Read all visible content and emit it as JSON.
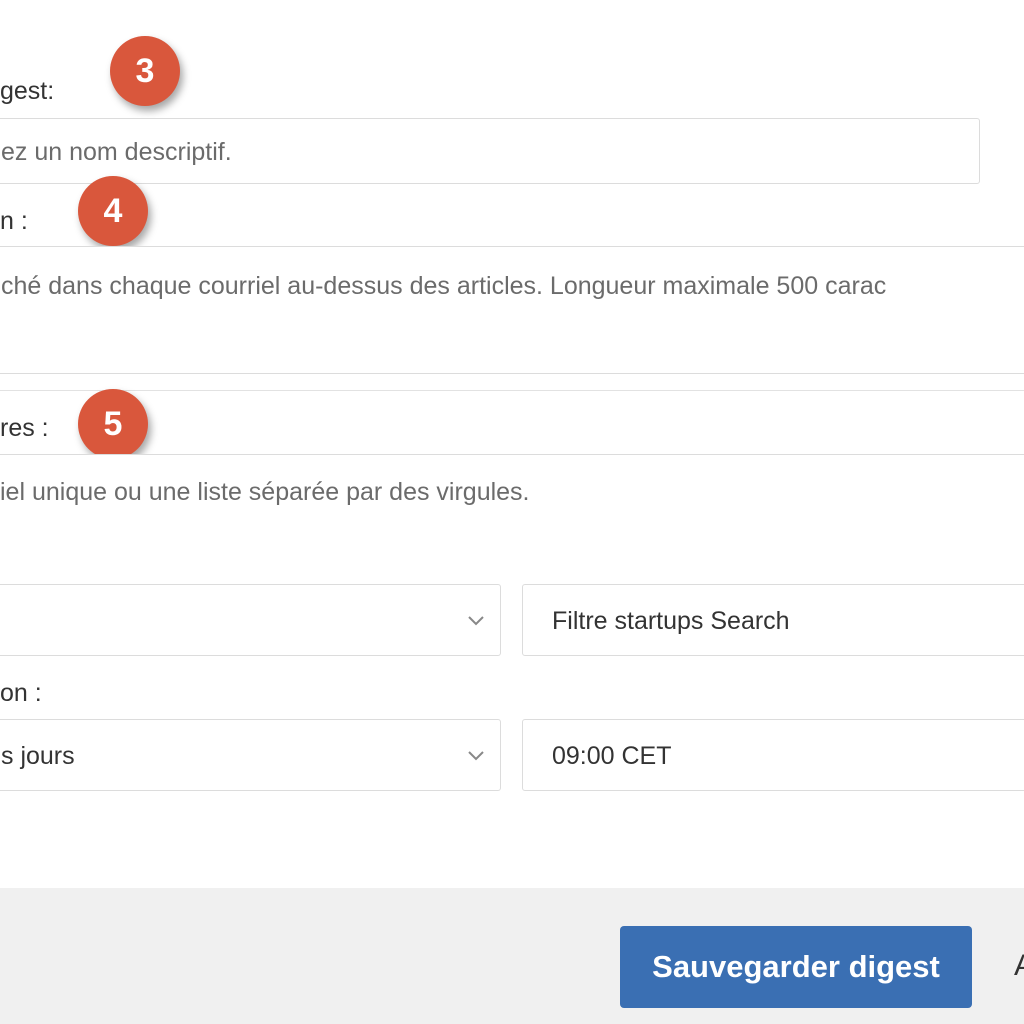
{
  "form": {
    "name_label": "gest:",
    "name_placeholder": "ez un nom descriptif.",
    "intro_label": "n :",
    "intro_placeholder": "ché dans chaque courriel au-dessus des articles. Longueur maximale 500 carac",
    "recipients_label": "res :",
    "recipients_placeholder": "iel unique ou une liste séparée par des virgules.",
    "filter_select_value": "",
    "filter_value": "Filtre startups Search",
    "frequency_label": "on :",
    "frequency_select_value": "s jours",
    "time_value": "09:00 CET"
  },
  "badges": {
    "b3": "3",
    "b4": "4",
    "b5": "5"
  },
  "footer": {
    "save_label": "Sauvegarder digest",
    "next_label": "A"
  },
  "colors": {
    "badge": "#d9573c",
    "primary_button": "#3a6fb3",
    "footer_bg": "#f0f0f0"
  }
}
